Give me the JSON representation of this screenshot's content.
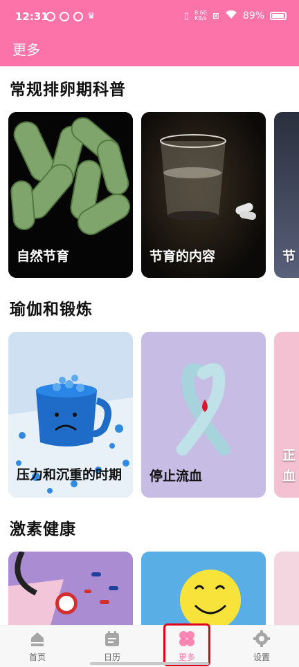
{
  "status_bar": {
    "time": "12:31",
    "net_speed_value": "8.60",
    "net_speed_unit": "KB/s",
    "battery_percent": "89%"
  },
  "header": {
    "title": "更多"
  },
  "sections": [
    {
      "title": "常规排卵期科普",
      "cards": [
        {
          "label": "自然节育",
          "image": "green-bacteria-image"
        },
        {
          "label": "节育的内容",
          "image": "glass-of-water-with-pills-image"
        },
        {
          "label": "节",
          "image": "dark-partial-image"
        }
      ]
    },
    {
      "title": "瑜伽和锻炼",
      "cards": [
        {
          "label": "压力和沉重的时期",
          "image": "sad-blue-mug-with-confetti-image"
        },
        {
          "label": "停止流血",
          "image": "light-blue-ribbon-with-drop-image"
        },
        {
          "label": "正血",
          "image": "pink-partial-image"
        }
      ]
    },
    {
      "title": "激素健康",
      "cards": [
        {
          "label": "",
          "image": "stethoscope-and-clock-image"
        },
        {
          "label": "",
          "image": "yellow-smiley-face-image"
        },
        {
          "label": "",
          "image": "pink-flower-partial-image"
        }
      ]
    }
  ],
  "bottom_nav": {
    "items": [
      {
        "label": "首页",
        "icon": "home-icon"
      },
      {
        "label": "日历",
        "icon": "calendar-icon"
      },
      {
        "label": "更多",
        "icon": "flower-icon"
      },
      {
        "label": "设置",
        "icon": "gear-icon"
      }
    ],
    "active": "更多"
  },
  "colors": {
    "brand": "#fb73a8",
    "highlight": "#e1001a"
  }
}
